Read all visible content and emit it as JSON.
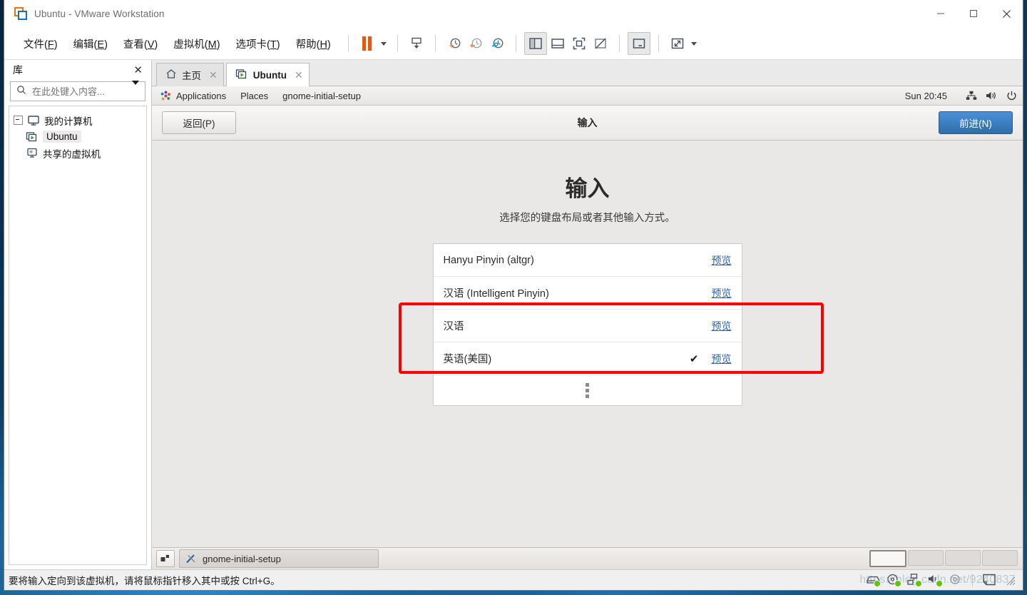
{
  "window": {
    "title": "Ubuntu - VMware Workstation",
    "app_icon": "vmware-logo-icon",
    "controls": {
      "minimize": "minimize-icon",
      "maximize": "maximize-icon",
      "close": "close-icon"
    }
  },
  "menubar": {
    "items": [
      {
        "label": "文件(F)",
        "text": "文件",
        "accel": "F"
      },
      {
        "label": "编辑(E)",
        "text": "编辑",
        "accel": "E"
      },
      {
        "label": "查看(V)",
        "text": "查看",
        "accel": "V"
      },
      {
        "label": "虚拟机(M)",
        "text": "虚拟机",
        "accel": "M"
      },
      {
        "label": "选项卡(T)",
        "text": "选项卡",
        "accel": "T"
      },
      {
        "label": "帮助(H)",
        "text": "帮助",
        "accel": "H"
      }
    ],
    "toolbar": [
      {
        "name": "suspend-pause-icon",
        "color": "#e8580c"
      },
      {
        "name": "suspend-dropdown-caret-icon"
      },
      {
        "name": "power-on-vm-icon"
      },
      {
        "name": "take-snapshot-icon"
      },
      {
        "name": "revert-snapshot-icon"
      },
      {
        "name": "manage-snapshots-icon"
      },
      {
        "name": "show-library-panel-icon"
      },
      {
        "name": "show-thumbnail-bar-icon"
      },
      {
        "name": "enter-fullscreen-icon"
      },
      {
        "name": "enter-unity-mode-icon"
      },
      {
        "name": "console-view-icon"
      },
      {
        "name": "stretch-display-icon"
      },
      {
        "name": "stretch-dropdown-caret-icon"
      }
    ]
  },
  "library": {
    "title": "库",
    "close_label": "✕",
    "search": {
      "placeholder": "在此处键入内容...",
      "value": "",
      "icon": "search-icon",
      "dropdown_icon": "chevron-down-icon"
    },
    "tree": [
      {
        "label": "我的计算机",
        "icon": "computer-icon",
        "level": 0,
        "expanded": true,
        "selected": false
      },
      {
        "label": "Ubuntu",
        "icon": "vm-running-icon",
        "level": 1,
        "expanded": false,
        "selected": true
      },
      {
        "label": "共享的虚拟机",
        "icon": "shared-vms-icon",
        "level": 0,
        "expanded": false,
        "selected": false
      }
    ]
  },
  "tabs": [
    {
      "label": "主页",
      "icon": "home-icon",
      "active": false,
      "close_label": "✕"
    },
    {
      "label": "Ubuntu",
      "icon": "vm-running-icon",
      "active": true,
      "close_label": "✕"
    }
  ],
  "gnome": {
    "topbar": {
      "menus": [
        "Applications",
        "Places"
      ],
      "app_menu_icon": "ubuntu-applications-icon",
      "window_title": "gnome-initial-setup",
      "clock": "Sun 20:45",
      "tray": [
        "network-icon",
        "volume-icon",
        "power-icon"
      ]
    },
    "setup": {
      "back_button": "返回(P)",
      "header_title": "输入",
      "next_button": "前进(N)",
      "heading": "输入",
      "subheading": "选择您的键盘布局或者其他输入方式。",
      "input_methods": [
        {
          "name": "Hanyu Pinyin (altgr)",
          "selected": false,
          "preview_label": "预览"
        },
        {
          "name": "汉语 (Intelligent Pinyin)",
          "selected": false,
          "preview_label": "预览"
        },
        {
          "name": "汉语",
          "selected": false,
          "preview_label": "预览"
        },
        {
          "name": "英语(美国)",
          "selected": true,
          "check_glyph": "✔",
          "preview_label": "预览"
        }
      ],
      "more_handle_icon": "more-options-dots-icon"
    },
    "bottombar": {
      "show_desktop_icon": "show-desktop-icon",
      "task": {
        "label": "gnome-initial-setup",
        "icon": "tools-icon"
      },
      "workspaces": [
        {
          "active": true
        },
        {
          "active": false
        },
        {
          "active": false
        },
        {
          "active": false
        }
      ]
    }
  },
  "annotation": {
    "type": "red-highlight-rectangle",
    "color": "#ff0000",
    "targets": "英语(美国)"
  },
  "statusbar": {
    "message": "要将输入定向到该虚拟机，请将鼠标指针移入其中或按 Ctrl+G。",
    "icons": [
      "hard-disk-icon",
      "cd-dvd-icon",
      "network-adapter-icon",
      "sound-card-icon",
      "printer-icon",
      "usb-display-icon"
    ],
    "resize_grip": "resize-grip-icon",
    "watermark": "https://blog.csdn.net/9240837"
  }
}
